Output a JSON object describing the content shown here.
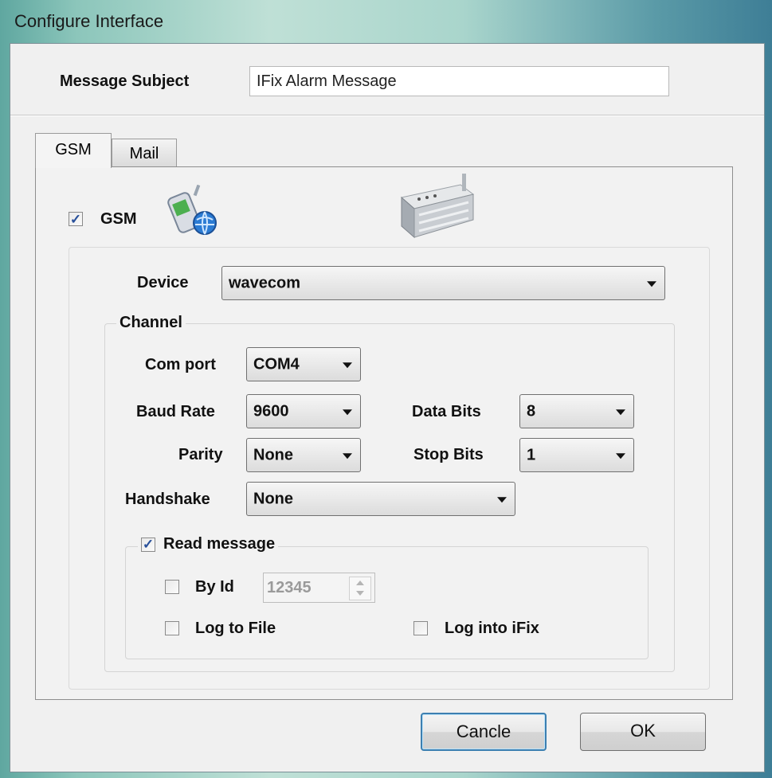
{
  "window": {
    "title": "Configure Interface"
  },
  "message_subject": {
    "label": "Message  Subject",
    "value": "IFix Alarm Message"
  },
  "tabs": [
    {
      "label": "GSM",
      "selected": true
    },
    {
      "label": "Mail",
      "selected": false
    }
  ],
  "gsm": {
    "enable_label": "GSM",
    "enable_checked": true,
    "device": {
      "label": "Device",
      "value": "wavecom"
    },
    "channel": {
      "title": "Channel",
      "com_port": {
        "label": "Com port",
        "value": "COM4"
      },
      "baud_rate": {
        "label": "Baud Rate",
        "value": "9600"
      },
      "data_bits": {
        "label": "Data Bits",
        "value": "8"
      },
      "parity": {
        "label": "Parity",
        "value": "None"
      },
      "stop_bits": {
        "label": "Stop Bits",
        "value": "1"
      },
      "handshake": {
        "label": "Handshake",
        "value": "None"
      }
    },
    "read_message": {
      "label": "Read message",
      "checked": true,
      "by_id": {
        "label": "By Id",
        "checked": false,
        "value": "12345"
      },
      "log_to_file": {
        "label": "Log to File",
        "checked": false
      },
      "log_into_ifix": {
        "label": "Log into iFix",
        "checked": false
      }
    }
  },
  "buttons": {
    "cancel": "Cancle",
    "ok": "OK"
  },
  "icons": {
    "phone": "mobile-phone-globe-icon",
    "modem": "gsm-modem-icon"
  }
}
